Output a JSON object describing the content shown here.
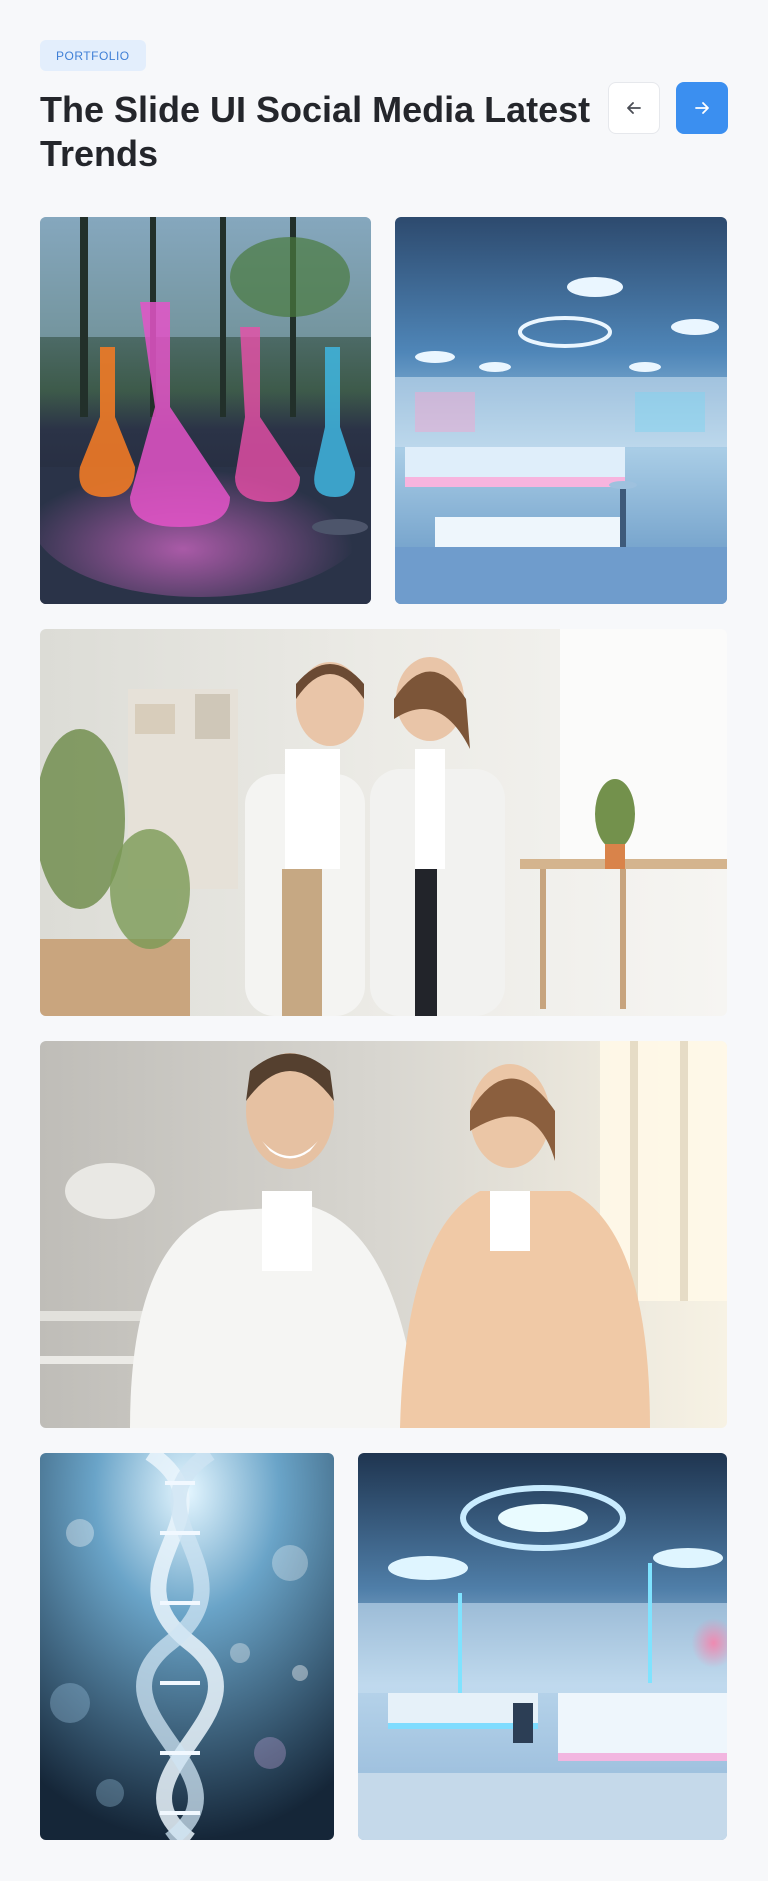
{
  "header": {
    "badge": "PORTFOLIO",
    "title": "The Slide UI Social Media Latest Trends"
  },
  "nav": {
    "prev_icon": "arrow-left-icon",
    "next_icon": "arrow-right-icon"
  },
  "gallery": {
    "images": [
      {
        "name": "lab-flasks-image",
        "subject": "colorful chemistry flasks"
      },
      {
        "name": "futuristic-lab-image",
        "subject": "futuristic laboratory interior"
      },
      {
        "name": "two-scientists-image",
        "subject": "two scientists in lab coats"
      },
      {
        "name": "smiling-scientists-image",
        "subject": "two smiling scientists"
      },
      {
        "name": "dna-helix-image",
        "subject": "DNA double helix"
      },
      {
        "name": "neon-lab-image",
        "subject": "neon-lit laboratory"
      }
    ]
  },
  "colors": {
    "accent": "#3b8ff0",
    "badge_bg": "#e3eefc",
    "badge_text": "#3f7fd6",
    "background": "#f7f8fa"
  }
}
